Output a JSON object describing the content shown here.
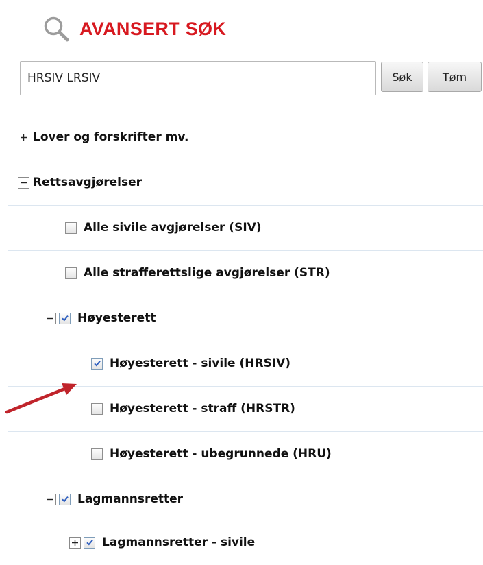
{
  "header": {
    "title": "AVANSERT SØK",
    "icon": "search-icon"
  },
  "search": {
    "value": "HRSIV LRSIV",
    "search_button": "Søk",
    "clear_button": "Tøm"
  },
  "colors": {
    "title": "#d71920",
    "check": "#2f5fbf",
    "arrow": "#c0242b"
  },
  "tree": [
    {
      "label": "Lover og forskrifter mv.",
      "toggle": "expand",
      "checkbox": false,
      "checked": false
    },
    {
      "label": "Rettsavgjørelser",
      "toggle": "collapse",
      "checkbox": false,
      "checked": false
    },
    {
      "label": "Alle sivile avgjørelser (SIV)",
      "toggle": "none",
      "checkbox": true,
      "checked": false
    },
    {
      "label": "Alle strafferettslige avgjørelser (STR)",
      "toggle": "none",
      "checkbox": true,
      "checked": false
    },
    {
      "label": "Høyesterett",
      "toggle": "collapse",
      "checkbox": true,
      "checked": true
    },
    {
      "label": "Høyesterett - sivile (HRSIV)",
      "toggle": "none",
      "checkbox": true,
      "checked": true
    },
    {
      "label": "Høyesterett - straff (HRSTR)",
      "toggle": "none",
      "checkbox": true,
      "checked": false
    },
    {
      "label": "Høyesterett - ubegrunnede (HRU)",
      "toggle": "none",
      "checkbox": true,
      "checked": false
    },
    {
      "label": "Lagmannsretter",
      "toggle": "collapse",
      "checkbox": true,
      "checked": true
    },
    {
      "label": "Lagmannsretter - sivile",
      "toggle": "expand",
      "checkbox": true,
      "checked": true
    }
  ]
}
